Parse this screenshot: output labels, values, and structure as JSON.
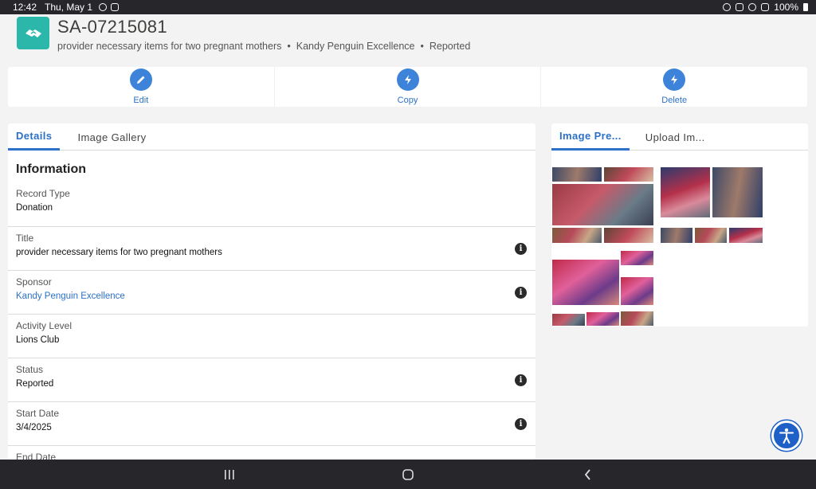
{
  "status_bar": {
    "time": "12:42",
    "date": "Thu, May 1",
    "battery": "100%"
  },
  "header": {
    "record_id": "SA-07215081",
    "title": "provider necessary items for two pregnant mothers",
    "sponsor": "Kandy Penguin Excellence",
    "status": "Reported",
    "icon": "handshake-icon",
    "icon_bg": "#2bb7a9"
  },
  "actions": [
    {
      "label": "Edit",
      "icon": "pencil-icon"
    },
    {
      "label": "Copy",
      "icon": "lightning-icon"
    },
    {
      "label": "Delete",
      "icon": "lightning-icon"
    }
  ],
  "details": {
    "tabs": [
      "Details",
      "Image Gallery"
    ],
    "active_tab": "Details",
    "section_title": "Information",
    "fields": [
      {
        "label": "Record Type",
        "value": "Donation"
      },
      {
        "label": "Title",
        "value": "provider necessary items for two pregnant mothers"
      },
      {
        "label": "Sponsor",
        "value": "Kandy Penguin Excellence"
      },
      {
        "label": "Activity Level",
        "value": "Lions Club"
      },
      {
        "label": "Status",
        "value": "Reported"
      },
      {
        "label": "Start Date",
        "value": "3/4/2025"
      },
      {
        "label": "End Date",
        "value": ""
      }
    ]
  },
  "preview": {
    "tabs": [
      "Image Pre...",
      "Upload Im..."
    ],
    "active_tab": "Image Pre..."
  },
  "colors": {
    "accent": "#2c70c8",
    "action_circle": "#3d83d9",
    "page_bg": "#f3f3f3",
    "system_bar": "#26262b"
  }
}
